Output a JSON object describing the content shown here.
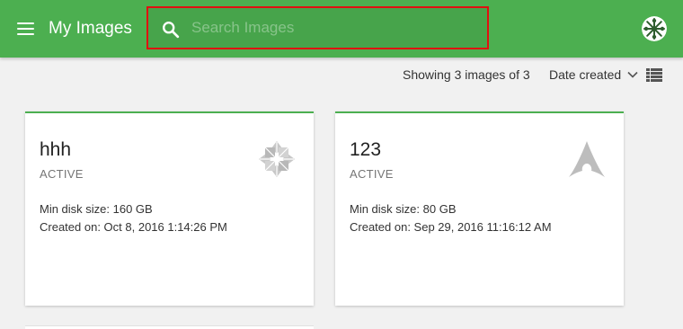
{
  "header": {
    "title": "My Images",
    "menu_icon": "hamburger-menu-icon",
    "avatar_icon": "snowflake-avatar-icon"
  },
  "search": {
    "placeholder": "Search Images",
    "value": "",
    "icon": "search-icon"
  },
  "toolbar": {
    "count_text": "Showing 3 images of 3",
    "sort_label": "Date created",
    "sort_icon": "chevron-down-icon",
    "view_icon": "list-view-icon"
  },
  "images": [
    {
      "name": "hhh",
      "status": "ACTIVE",
      "min_disk": "Min disk size: 160 GB",
      "created": "Created on: Oct 8, 2016 1:14:26 PM",
      "os_icon": "centos-icon"
    },
    {
      "name": "123",
      "status": "ACTIVE",
      "min_disk": "Min disk size: 80 GB",
      "created": "Created on: Sep 29, 2016 11:16:12 AM",
      "os_icon": "arch-linux-icon"
    }
  ],
  "colors": {
    "accent": "#4caf50",
    "highlight_border": "#e01010",
    "background": "#f1f1f1"
  }
}
